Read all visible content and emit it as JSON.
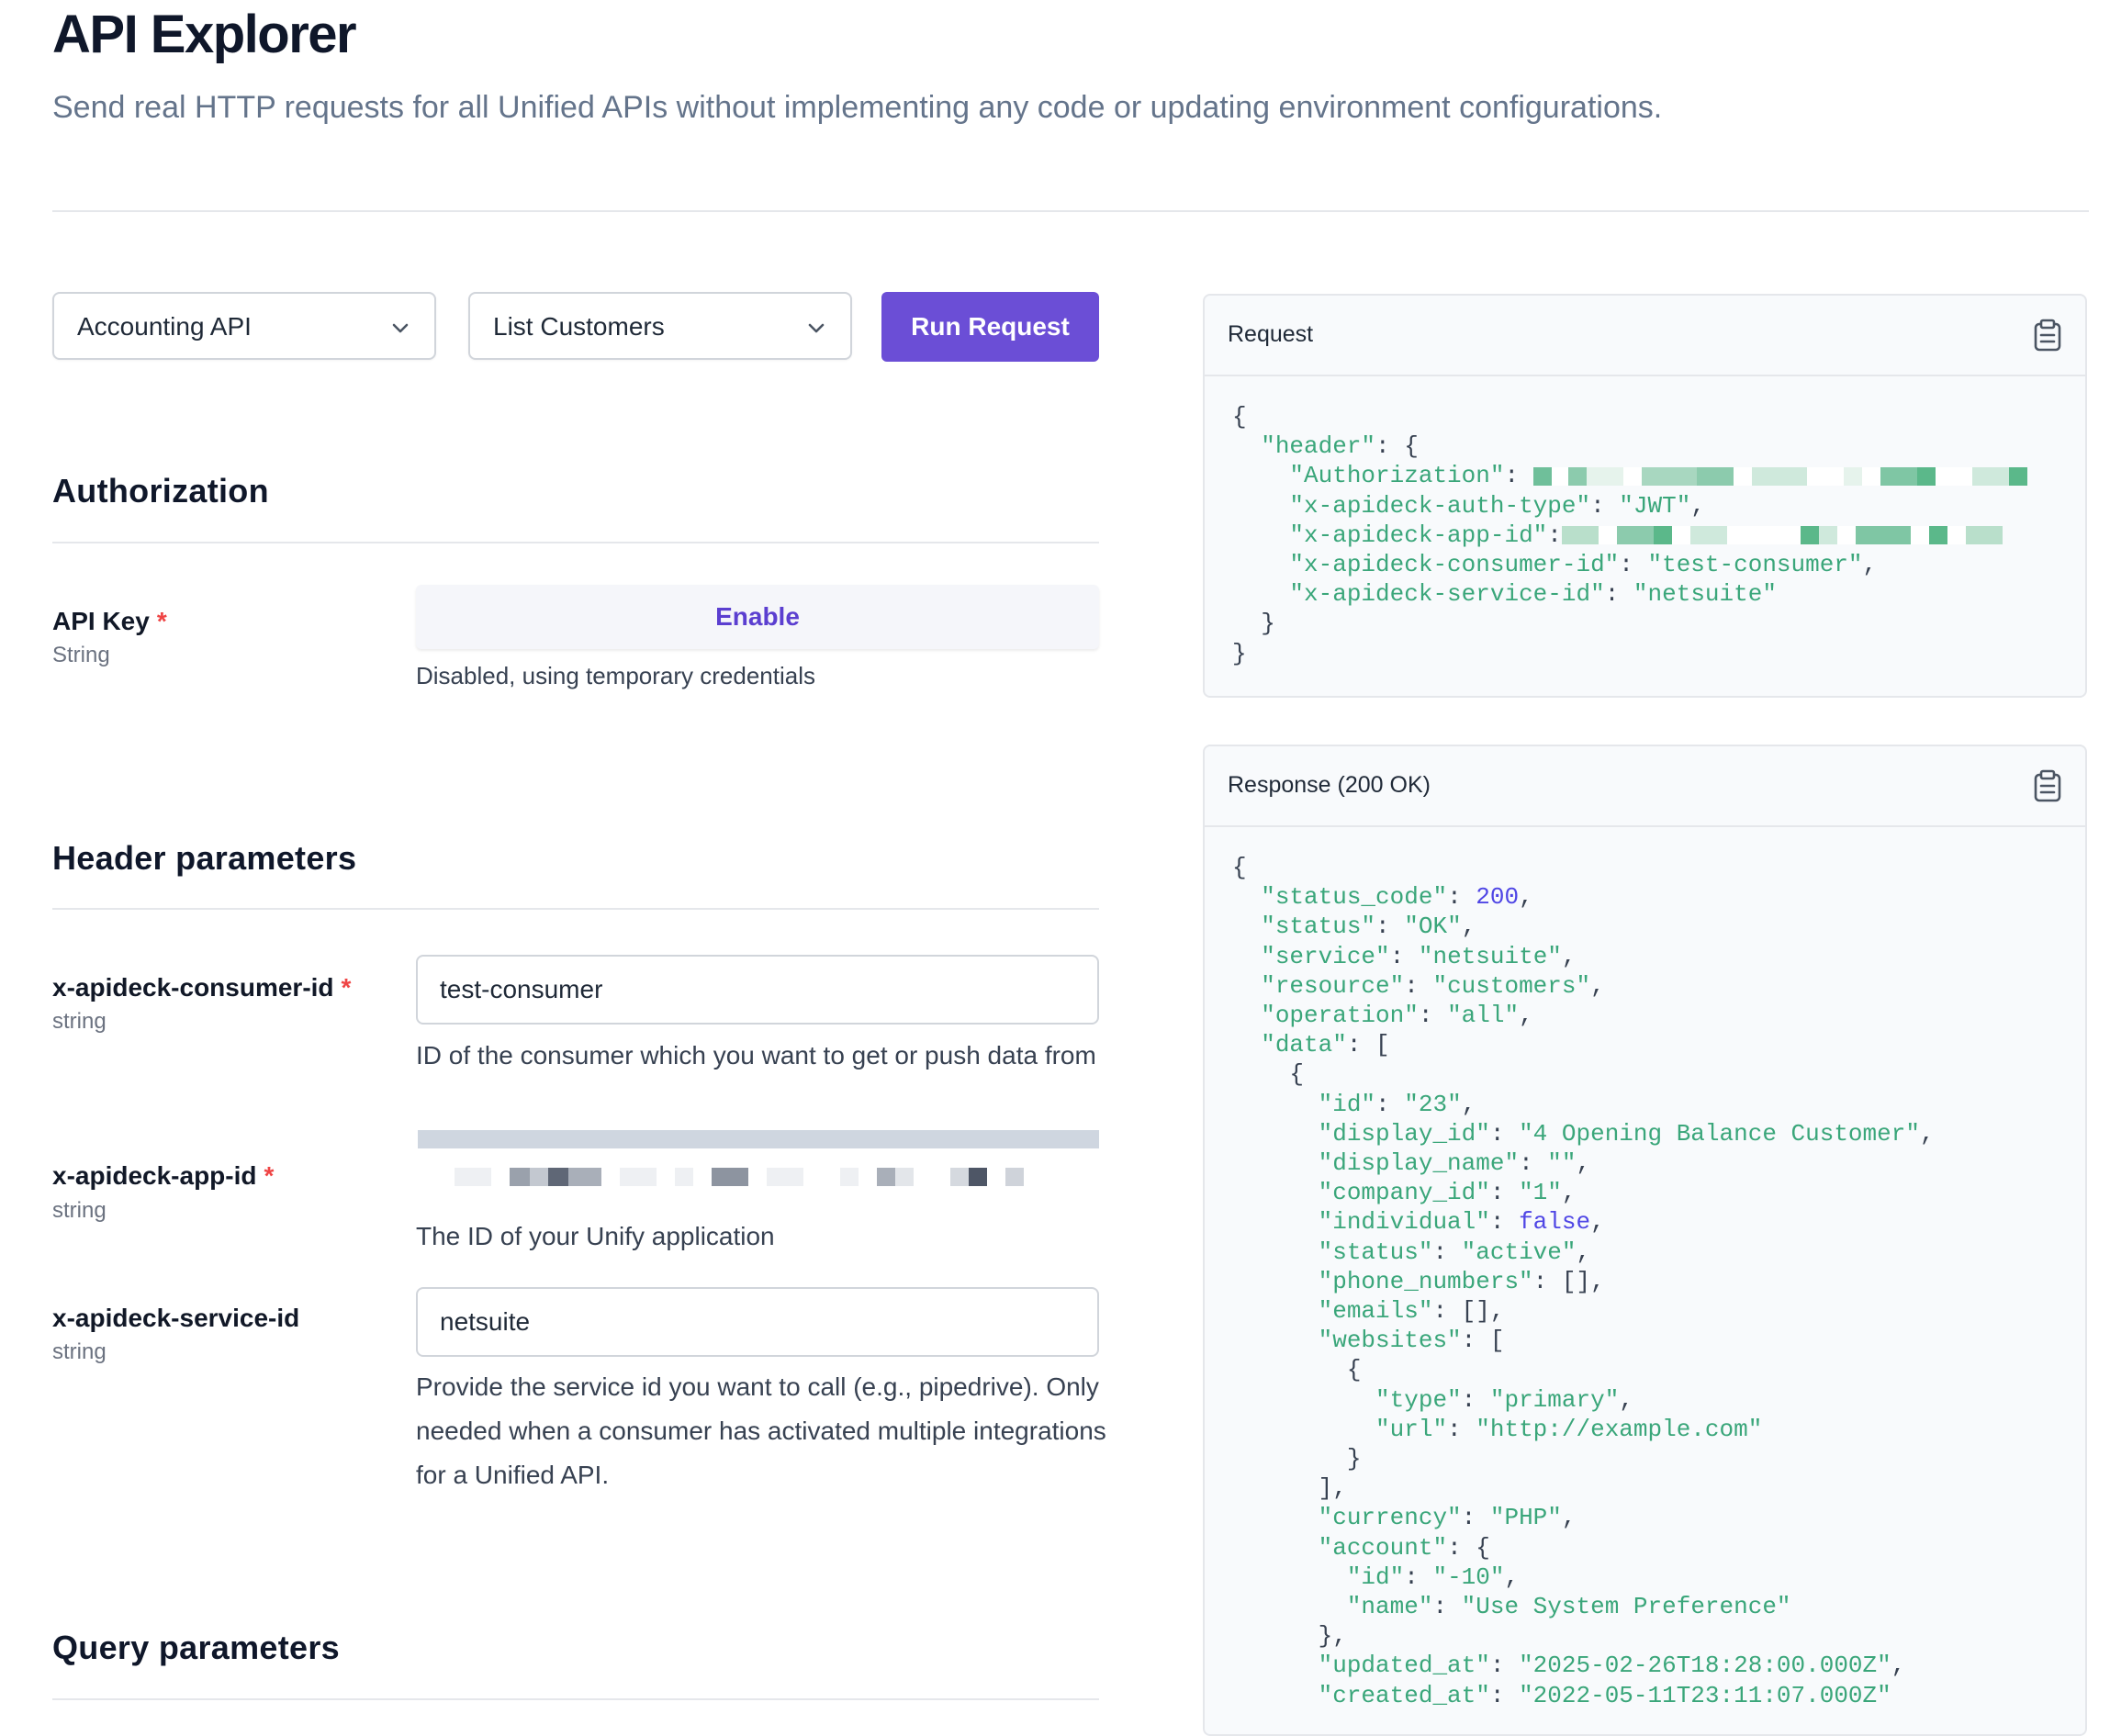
{
  "header": {
    "title": "API Explorer",
    "subtitle": "Send real HTTP requests for all Unified APIs without implementing any code or updating environment configurations."
  },
  "toolbar": {
    "api_select": "Accounting API",
    "operation_select": "List Customers",
    "run_label": "Run Request"
  },
  "authorization": {
    "title": "Authorization",
    "api_key": {
      "name": "API Key",
      "type": "String",
      "enable_label": "Enable",
      "status": "Disabled, using temporary credentials"
    }
  },
  "header_params": {
    "title": "Header parameters",
    "consumer_id": {
      "name": "x-apideck-consumer-id",
      "type": "string",
      "value": "test-consumer",
      "description": "ID of the consumer which you want to get or push data from"
    },
    "app_id": {
      "name": "x-apideck-app-id",
      "type": "string",
      "description": "The ID of your Unify application"
    },
    "service_id": {
      "name": "x-apideck-service-id",
      "type": "string",
      "value": "netsuite",
      "description": "Provide the service id you want to call (e.g., pipedrive). Only needed when a consumer has activated multiple integrations for a Unified API."
    }
  },
  "query_params": {
    "title": "Query parameters"
  },
  "request_panel": {
    "title": "Request",
    "code": {
      "open": "{",
      "header_key": "\"header\"",
      "auth_key": "\"Authorization\"",
      "auth_type_key": "\"x-apideck-auth-type\"",
      "auth_type_val": "\"JWT\"",
      "app_id_key": "\"x-apideck-app-id\"",
      "consumer_key": "\"x-apideck-consumer-id\"",
      "consumer_val": "\"test-consumer\"",
      "service_key": "\"x-apideck-service-id\"",
      "service_val": "\"netsuite\"",
      "inner_close": "}",
      "close": "}"
    }
  },
  "response_panel": {
    "title": "Response (200 OK)",
    "code": {
      "status_code_key": "\"status_code\"",
      "status_code_val": "200",
      "status_key": "\"status\"",
      "status_val": "\"OK\"",
      "service_key": "\"service\"",
      "service_val": "\"netsuite\"",
      "resource_key": "\"resource\"",
      "resource_val": "\"customers\"",
      "operation_key": "\"operation\"",
      "operation_val": "\"all\"",
      "data_key": "\"data\"",
      "id_key": "\"id\"",
      "id_val": "\"23\"",
      "display_id_key": "\"display_id\"",
      "display_id_val": "\"4 Opening Balance Customer\"",
      "display_name_key": "\"display_name\"",
      "display_name_val": "\"\"",
      "company_id_key": "\"company_id\"",
      "company_id_val": "\"1\"",
      "individual_key": "\"individual\"",
      "individual_val": "false",
      "cstatus_key": "\"status\"",
      "cstatus_val": "\"active\"",
      "phone_key": "\"phone_numbers\"",
      "emails_key": "\"emails\"",
      "websites_key": "\"websites\"",
      "type_key": "\"type\"",
      "type_val": "\"primary\"",
      "url_key": "\"url\"",
      "url_val": "\"http://example.com\"",
      "currency_key": "\"currency\"",
      "currency_val": "\"PHP\"",
      "account_key": "\"account\"",
      "acc_id_key": "\"id\"",
      "acc_id_val": "\"-10\"",
      "acc_name_key": "\"name\"",
      "acc_name_val": "\"Use System Preference\"",
      "updated_key": "\"updated_at\"",
      "updated_val": "\"2025-02-26T18:28:00.000Z\"",
      "created_key": "\"created_at\"",
      "created_val": "\"2022-05-11T23:11:07.000Z\""
    }
  },
  "icons": {
    "dropdown": "chevron-down-icon",
    "copy": "clipboard-icon"
  },
  "colors": {
    "accent": "#6b4ed6",
    "json_string": "#3aa67a",
    "json_number": "#4f46e5",
    "required": "#ef4444"
  }
}
